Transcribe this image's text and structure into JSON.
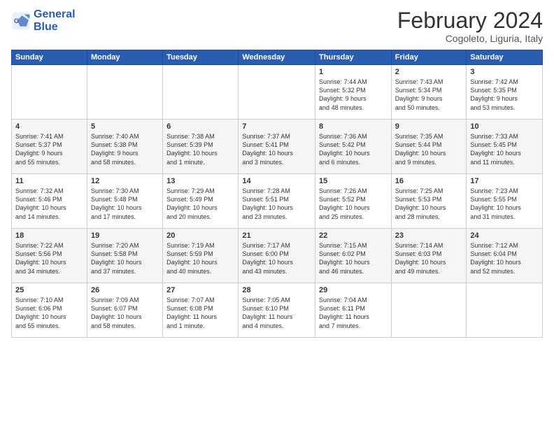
{
  "logo": {
    "text_general": "General",
    "text_blue": "Blue"
  },
  "header": {
    "month_year": "February 2024",
    "location": "Cogoleto, Liguria, Italy"
  },
  "weekdays": [
    "Sunday",
    "Monday",
    "Tuesday",
    "Wednesday",
    "Thursday",
    "Friday",
    "Saturday"
  ],
  "weeks": [
    [
      {
        "day": "",
        "info": ""
      },
      {
        "day": "",
        "info": ""
      },
      {
        "day": "",
        "info": ""
      },
      {
        "day": "",
        "info": ""
      },
      {
        "day": "1",
        "info": "Sunrise: 7:44 AM\nSunset: 5:32 PM\nDaylight: 9 hours\nand 48 minutes."
      },
      {
        "day": "2",
        "info": "Sunrise: 7:43 AM\nSunset: 5:34 PM\nDaylight: 9 hours\nand 50 minutes."
      },
      {
        "day": "3",
        "info": "Sunrise: 7:42 AM\nSunset: 5:35 PM\nDaylight: 9 hours\nand 53 minutes."
      }
    ],
    [
      {
        "day": "4",
        "info": "Sunrise: 7:41 AM\nSunset: 5:37 PM\nDaylight: 9 hours\nand 55 minutes."
      },
      {
        "day": "5",
        "info": "Sunrise: 7:40 AM\nSunset: 5:38 PM\nDaylight: 9 hours\nand 58 minutes."
      },
      {
        "day": "6",
        "info": "Sunrise: 7:38 AM\nSunset: 5:39 PM\nDaylight: 10 hours\nand 1 minute."
      },
      {
        "day": "7",
        "info": "Sunrise: 7:37 AM\nSunset: 5:41 PM\nDaylight: 10 hours\nand 3 minutes."
      },
      {
        "day": "8",
        "info": "Sunrise: 7:36 AM\nSunset: 5:42 PM\nDaylight: 10 hours\nand 6 minutes."
      },
      {
        "day": "9",
        "info": "Sunrise: 7:35 AM\nSunset: 5:44 PM\nDaylight: 10 hours\nand 9 minutes."
      },
      {
        "day": "10",
        "info": "Sunrise: 7:33 AM\nSunset: 5:45 PM\nDaylight: 10 hours\nand 11 minutes."
      }
    ],
    [
      {
        "day": "11",
        "info": "Sunrise: 7:32 AM\nSunset: 5:46 PM\nDaylight: 10 hours\nand 14 minutes."
      },
      {
        "day": "12",
        "info": "Sunrise: 7:30 AM\nSunset: 5:48 PM\nDaylight: 10 hours\nand 17 minutes."
      },
      {
        "day": "13",
        "info": "Sunrise: 7:29 AM\nSunset: 5:49 PM\nDaylight: 10 hours\nand 20 minutes."
      },
      {
        "day": "14",
        "info": "Sunrise: 7:28 AM\nSunset: 5:51 PM\nDaylight: 10 hours\nand 23 minutes."
      },
      {
        "day": "15",
        "info": "Sunrise: 7:26 AM\nSunset: 5:52 PM\nDaylight: 10 hours\nand 25 minutes."
      },
      {
        "day": "16",
        "info": "Sunrise: 7:25 AM\nSunset: 5:53 PM\nDaylight: 10 hours\nand 28 minutes."
      },
      {
        "day": "17",
        "info": "Sunrise: 7:23 AM\nSunset: 5:55 PM\nDaylight: 10 hours\nand 31 minutes."
      }
    ],
    [
      {
        "day": "18",
        "info": "Sunrise: 7:22 AM\nSunset: 5:56 PM\nDaylight: 10 hours\nand 34 minutes."
      },
      {
        "day": "19",
        "info": "Sunrise: 7:20 AM\nSunset: 5:58 PM\nDaylight: 10 hours\nand 37 minutes."
      },
      {
        "day": "20",
        "info": "Sunrise: 7:19 AM\nSunset: 5:59 PM\nDaylight: 10 hours\nand 40 minutes."
      },
      {
        "day": "21",
        "info": "Sunrise: 7:17 AM\nSunset: 6:00 PM\nDaylight: 10 hours\nand 43 minutes."
      },
      {
        "day": "22",
        "info": "Sunrise: 7:15 AM\nSunset: 6:02 PM\nDaylight: 10 hours\nand 46 minutes."
      },
      {
        "day": "23",
        "info": "Sunrise: 7:14 AM\nSunset: 6:03 PM\nDaylight: 10 hours\nand 49 minutes."
      },
      {
        "day": "24",
        "info": "Sunrise: 7:12 AM\nSunset: 6:04 PM\nDaylight: 10 hours\nand 52 minutes."
      }
    ],
    [
      {
        "day": "25",
        "info": "Sunrise: 7:10 AM\nSunset: 6:06 PM\nDaylight: 10 hours\nand 55 minutes."
      },
      {
        "day": "26",
        "info": "Sunrise: 7:09 AM\nSunset: 6:07 PM\nDaylight: 10 hours\nand 58 minutes."
      },
      {
        "day": "27",
        "info": "Sunrise: 7:07 AM\nSunset: 6:08 PM\nDaylight: 11 hours\nand 1 minute."
      },
      {
        "day": "28",
        "info": "Sunrise: 7:05 AM\nSunset: 6:10 PM\nDaylight: 11 hours\nand 4 minutes."
      },
      {
        "day": "29",
        "info": "Sunrise: 7:04 AM\nSunset: 6:11 PM\nDaylight: 11 hours\nand 7 minutes."
      },
      {
        "day": "",
        "info": ""
      },
      {
        "day": "",
        "info": ""
      }
    ]
  ]
}
